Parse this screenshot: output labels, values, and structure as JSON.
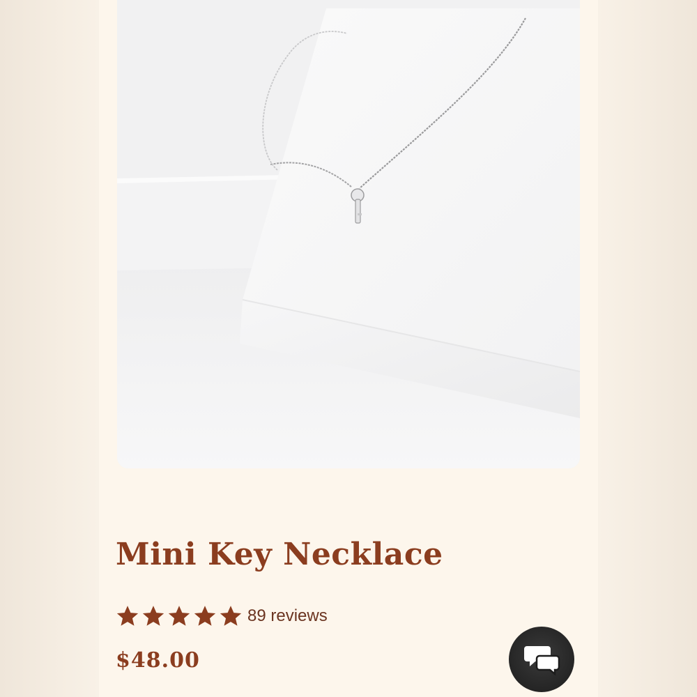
{
  "product": {
    "title": "Mini Key Necklace",
    "rating": 5,
    "reviews_label": "89 reviews",
    "price": "$48.00",
    "image_alt_icon": "necklace-photo"
  },
  "colors": {
    "brand": "#8b3d1f",
    "star": "#8b3d1f",
    "card_bg": "#fdf6ec",
    "chat_bg": "#1c1c1c"
  },
  "chat": {
    "icon": "chat-bubbles-icon"
  }
}
